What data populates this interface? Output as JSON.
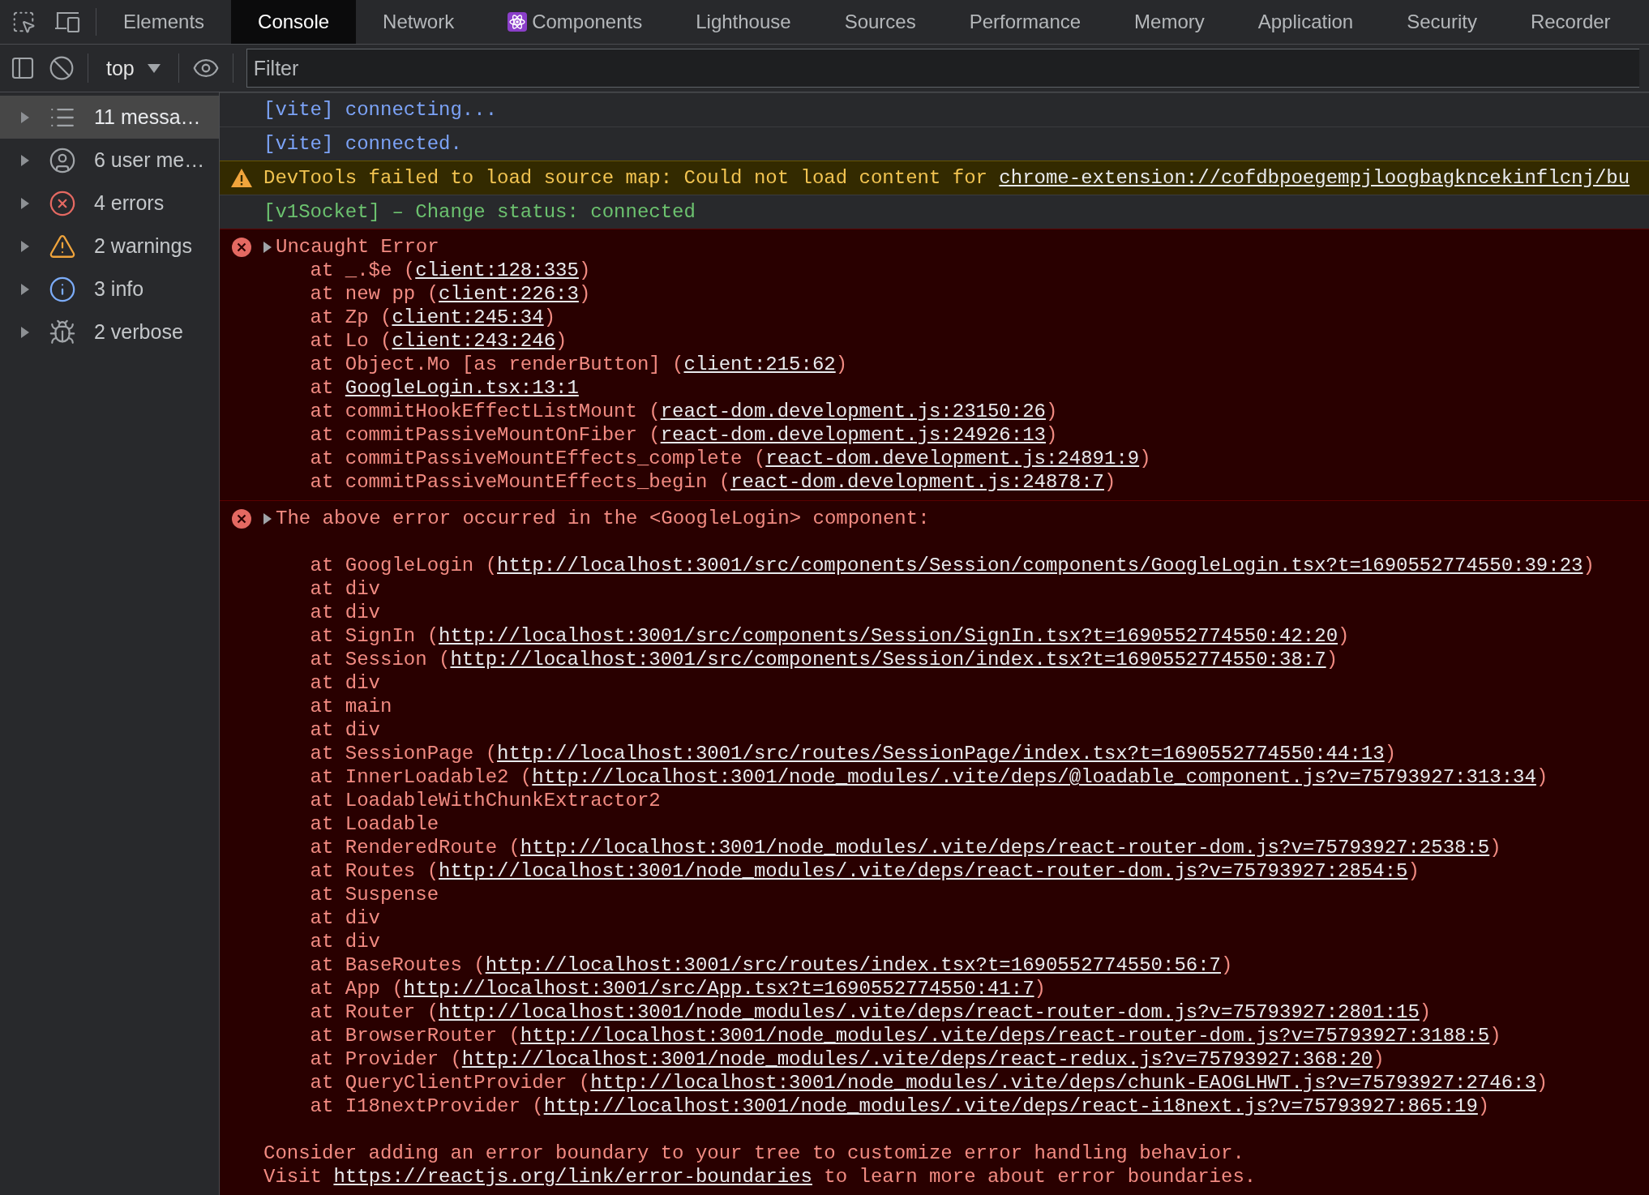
{
  "tabs": [
    {
      "label": "Elements",
      "kind": "panel",
      "selected": false
    },
    {
      "label": "Console",
      "kind": "panel",
      "selected": true
    },
    {
      "label": "Network",
      "kind": "panel",
      "selected": false
    },
    {
      "label": "Components",
      "kind": "extension",
      "selected": false
    },
    {
      "label": "Lighthouse",
      "kind": "panel",
      "selected": false
    },
    {
      "label": "Sources",
      "kind": "panel",
      "selected": false
    },
    {
      "label": "Performance",
      "kind": "panel",
      "selected": false
    },
    {
      "label": "Memory",
      "kind": "panel",
      "selected": false
    },
    {
      "label": "Application",
      "kind": "panel",
      "selected": false
    },
    {
      "label": "Security",
      "kind": "panel",
      "selected": false
    },
    {
      "label": "Recorder",
      "kind": "panel",
      "selected": false
    }
  ],
  "console_toolbar": {
    "context": "top",
    "filter_placeholder": "Filter"
  },
  "sidebar": {
    "items": [
      {
        "label": "11 messa…",
        "kind": "all",
        "selected": true
      },
      {
        "label": "6 user me…",
        "kind": "user",
        "selected": false
      },
      {
        "label": "4 errors",
        "kind": "error",
        "selected": false
      },
      {
        "label": "2 warnings",
        "kind": "warning",
        "selected": false
      },
      {
        "label": "3 info",
        "kind": "info",
        "selected": false
      },
      {
        "label": "2 verbose",
        "kind": "verbose",
        "selected": false
      }
    ]
  },
  "messages": [
    {
      "kind": "log",
      "color": "#7ca3f7",
      "text": "[vite] connecting..."
    },
    {
      "kind": "log",
      "color": "#7ca3f7",
      "text": "[vite] connected."
    },
    {
      "kind": "warning",
      "text": "DevTools failed to load source map: Could not load content for ",
      "link": "chrome-extension://cofdbpoegempjloogbagkncekinflcnj/bu"
    },
    {
      "kind": "log",
      "color": "#6cc26f",
      "text": "[v1Socket] – Change status: connected"
    },
    {
      "kind": "error",
      "expanded": false,
      "title": "Uncaught Error",
      "blank_after_title": false,
      "stack": [
        {
          "prefix": "at _.$e (",
          "link": "client:128:335",
          "suffix": ")"
        },
        {
          "prefix": "at new pp (",
          "link": "client:226:3",
          "suffix": ")"
        },
        {
          "prefix": "at Zp (",
          "link": "client:245:34",
          "suffix": ")"
        },
        {
          "prefix": "at Lo (",
          "link": "client:243:246",
          "suffix": ")"
        },
        {
          "prefix": "at Object.Mo [as renderButton] (",
          "link": "client:215:62",
          "suffix": ")"
        },
        {
          "prefix": "at ",
          "link": "GoogleLogin.tsx:13:1"
        },
        {
          "prefix": "at commitHookEffectListMount (",
          "link": "react-dom.development.js:23150:26",
          "suffix": ")"
        },
        {
          "prefix": "at commitPassiveMountOnFiber (",
          "link": "react-dom.development.js:24926:13",
          "suffix": ")"
        },
        {
          "prefix": "at commitPassiveMountEffects_complete (",
          "link": "react-dom.development.js:24891:9",
          "suffix": ")"
        },
        {
          "prefix": "at commitPassiveMountEffects_begin (",
          "link": "react-dom.development.js:24878:7",
          "suffix": ")"
        }
      ]
    },
    {
      "kind": "error",
      "expanded": false,
      "title": "The above error occurred in the <GoogleLogin> component:",
      "blank_after_title": true,
      "stack": [
        {
          "prefix": "at GoogleLogin (",
          "link": "http://localhost:3001/src/components/Session/components/GoogleLogin.tsx?t=1690552774550:39:23",
          "suffix": ")"
        },
        {
          "prefix": "at div"
        },
        {
          "prefix": "at div"
        },
        {
          "prefix": "at SignIn (",
          "link": "http://localhost:3001/src/components/Session/SignIn.tsx?t=1690552774550:42:20",
          "suffix": ")"
        },
        {
          "prefix": "at Session (",
          "link": "http://localhost:3001/src/components/Session/index.tsx?t=1690552774550:38:7",
          "suffix": ")"
        },
        {
          "prefix": "at div"
        },
        {
          "prefix": "at main"
        },
        {
          "prefix": "at div"
        },
        {
          "prefix": "at SessionPage (",
          "link": "http://localhost:3001/src/routes/SessionPage/index.tsx?t=1690552774550:44:13",
          "suffix": ")"
        },
        {
          "prefix": "at InnerLoadable2 (",
          "link": "http://localhost:3001/node_modules/.vite/deps/@loadable_component.js?v=75793927:313:34",
          "suffix": ")"
        },
        {
          "prefix": "at LoadableWithChunkExtractor2"
        },
        {
          "prefix": "at Loadable"
        },
        {
          "prefix": "at RenderedRoute (",
          "link": "http://localhost:3001/node_modules/.vite/deps/react-router-dom.js?v=75793927:2538:5",
          "suffix": ")"
        },
        {
          "prefix": "at Routes (",
          "link": "http://localhost:3001/node_modules/.vite/deps/react-router-dom.js?v=75793927:2854:5",
          "suffix": ")"
        },
        {
          "prefix": "at Suspense"
        },
        {
          "prefix": "at div"
        },
        {
          "prefix": "at div"
        },
        {
          "prefix": "at BaseRoutes (",
          "link": "http://localhost:3001/src/routes/index.tsx?t=1690552774550:56:7",
          "suffix": ")"
        },
        {
          "prefix": "at App (",
          "link": "http://localhost:3001/src/App.tsx?t=1690552774550:41:7",
          "suffix": ")"
        },
        {
          "prefix": "at Router (",
          "link": "http://localhost:3001/node_modules/.vite/deps/react-router-dom.js?v=75793927:2801:15",
          "suffix": ")"
        },
        {
          "prefix": "at BrowserRouter (",
          "link": "http://localhost:3001/node_modules/.vite/deps/react-router-dom.js?v=75793927:3188:5",
          "suffix": ")"
        },
        {
          "prefix": "at Provider (",
          "link": "http://localhost:3001/node_modules/.vite/deps/react-redux.js?v=75793927:368:20",
          "suffix": ")"
        },
        {
          "prefix": "at QueryClientProvider (",
          "link": "http://localhost:3001/node_modules/.vite/deps/chunk-EAOGLHWT.js?v=75793927:2746:3",
          "suffix": ")"
        },
        {
          "prefix": "at I18nextProvider (",
          "link": "http://localhost:3001/node_modules/.vite/deps/react-i18next.js?v=75793927:865:19",
          "suffix": ")"
        }
      ],
      "footer": [
        {
          "prefix": "Consider adding an error boundary to your tree to customize error handling behavior."
        },
        {
          "prefix": "Visit ",
          "link": "https://reactjs.org/link/error-boundaries",
          "suffix": " to learn more about error boundaries."
        }
      ]
    }
  ]
}
